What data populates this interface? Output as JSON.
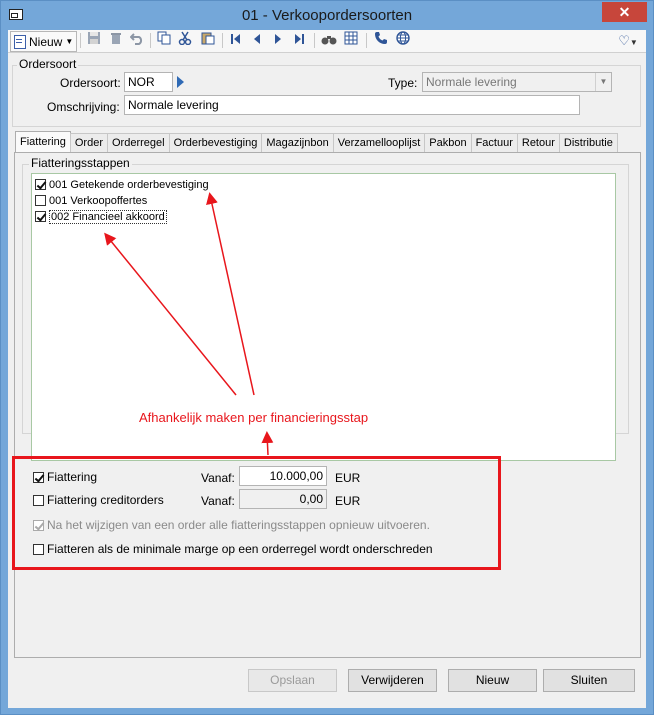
{
  "window": {
    "title": "01 - Verkoopordersoorten",
    "close_symbol": "✕"
  },
  "toolbar": {
    "new_label": "Nieuw",
    "icons": [
      "save-icon",
      "delete-icon",
      "undo-icon",
      "copy-icon",
      "cut-icon",
      "paste-icon",
      "first-icon",
      "prev-icon",
      "next-icon",
      "last-icon",
      "binoculars-icon",
      "grid-icon",
      "phone-icon",
      "globe-icon",
      "favorite-icon"
    ]
  },
  "ordersoort": {
    "group_label": "Ordersoort",
    "code_label": "Ordersoort:",
    "code_value": "NOR",
    "type_label": "Type:",
    "type_value": "Normale levering",
    "description_label": "Omschrijving:",
    "description_value": "Normale levering"
  },
  "tabs": [
    "Fiattering",
    "Order",
    "Orderregel",
    "Orderbevestiging",
    "Magazijnbon",
    "Verzamellooplijst",
    "Pakbon",
    "Factuur",
    "Retour",
    "Distributie"
  ],
  "fiattering": {
    "group_label": "Fiatteringsstappen",
    "steps": [
      {
        "label": "001 Getekende orderbevestiging",
        "checked": true
      },
      {
        "label": "001 Verkoopoffertes",
        "checked": false
      },
      {
        "label": "002 Financieel akkoord",
        "checked": true
      }
    ],
    "fiattering_label": "Fiattering",
    "fiattering_checked": true,
    "vanaf_label": "Vanaf:",
    "vanaf_value": "10.000,00",
    "currency": "EUR",
    "credit_label": "Fiattering creditorders",
    "credit_checked": false,
    "credit_vanaf_value": "0,00",
    "reapply_label": "Na het wijzigen van een order alle fiatteringsstappen opnieuw uitvoeren.",
    "reapply_checked": true,
    "margin_label": "Fiatteren als de minimale marge op een orderregel wordt onderschreden",
    "margin_checked": false
  },
  "annotation": {
    "text": "Afhankelijk maken per financieringsstap",
    "color": "#e8161c"
  },
  "buttons": {
    "save": "Opslaan",
    "delete": "Verwijderen",
    "new": "Nieuw",
    "close": "Sluiten"
  }
}
